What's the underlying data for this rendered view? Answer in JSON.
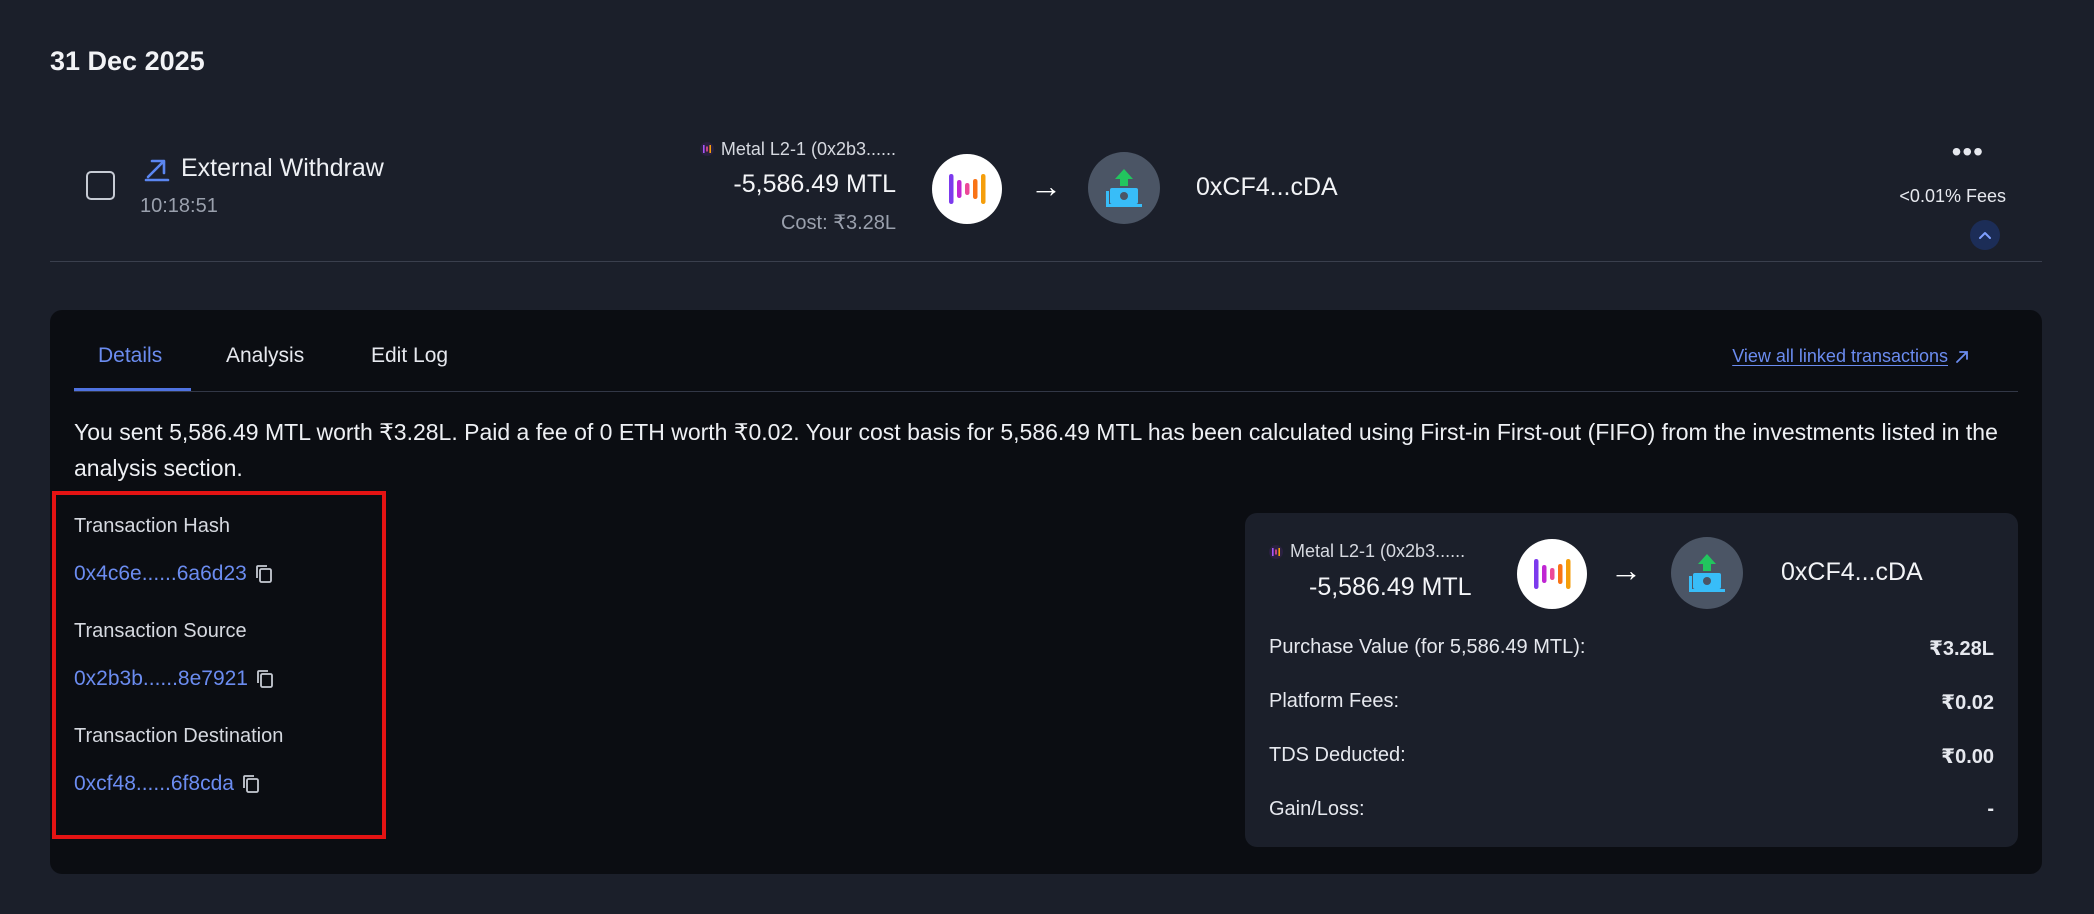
{
  "date_heading": "31 Dec 2025",
  "transaction": {
    "type_label": "External Withdraw",
    "time": "10:18:51",
    "asset_line": "Metal L2-1 (0x2b3......",
    "amount": "-5,586.49 MTL",
    "cost": "Cost: ₹3.28L",
    "destination": "0xCF4...cDA",
    "fees": "<0.01% Fees",
    "icons": {
      "type": "arrow-up-right-icon",
      "token": "metal-token-icon",
      "wallet": "withdraw-wallet-icon",
      "more": "more-icon",
      "collapse": "chevron-up-icon"
    }
  },
  "details": {
    "tabs": [
      {
        "label": "Details",
        "active": true
      },
      {
        "label": "Analysis",
        "active": false
      },
      {
        "label": "Edit Log",
        "active": false
      }
    ],
    "linked_link": "View all linked transactions",
    "summary": "You sent 5,586.49 MTL worth ₹3.28L. Paid a fee of 0 ETH worth ₹0.02. Your cost basis for 5,586.49 MTL has been calculated using First-in First-out (FIFO) from the investments listed in the analysis section.",
    "fields": [
      {
        "label": "Transaction Hash",
        "value": "0x4c6e......6a6d23"
      },
      {
        "label": "Transaction Source",
        "value": "0x2b3b......8e7921"
      },
      {
        "label": "Transaction Destination",
        "value": "0xcf48......6f8cda"
      }
    ],
    "card": {
      "asset_line": "Metal L2-1 (0x2b3......",
      "amount": "-5,586.49 MTL",
      "destination": "0xCF4...cDA",
      "rows": [
        {
          "label": "Purchase Value (for 5,586.49 MTL):",
          "value": "₹3.28L"
        },
        {
          "label": "Platform Fees:",
          "value": "₹0.02"
        },
        {
          "label": "TDS Deducted:",
          "value": "₹0.00"
        },
        {
          "label": "Gain/Loss:",
          "value": "-"
        }
      ]
    }
  },
  "colors": {
    "background": "#1b1f2a",
    "panel": "#0b0d12",
    "accent": "#6b8cf0",
    "highlight": "#e51313"
  }
}
